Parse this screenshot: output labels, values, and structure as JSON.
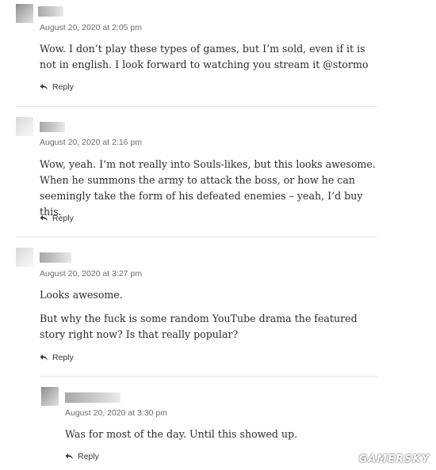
{
  "comments": [
    {
      "date": "August 20, 2020 at 2:05 pm",
      "paragraphs": [
        "Wow. I don’t play these types of games, but I’m sold, even if it is not in english. I look forward to watching you stream it @stormo"
      ],
      "reply_label": "Reply"
    },
    {
      "date": "August 20, 2020 at 2:16 pm",
      "paragraphs": [
        "Wow, yeah. I’m not really into Souls-likes, but this looks awesome. When he summons the army to attack the boss, or how he can seemingly take the form of his defeated enemies – yeah, I’d buy this."
      ],
      "reply_label": "Reply"
    },
    {
      "date": "August 20, 2020 at 3:27 pm",
      "paragraphs": [
        "Looks awesome.",
        "But why the fuck is some random YouTube drama the featured story right now? Is that really popular?"
      ],
      "reply_label": "Reply"
    },
    {
      "date": "August 20, 2020 at 3:30 pm",
      "paragraphs": [
        "Was for most of the day. Until this showed up."
      ],
      "reply_label": "Reply"
    }
  ],
  "watermark": "GAMERSKY",
  "icons": {
    "reply": "reply-arrow-icon"
  }
}
